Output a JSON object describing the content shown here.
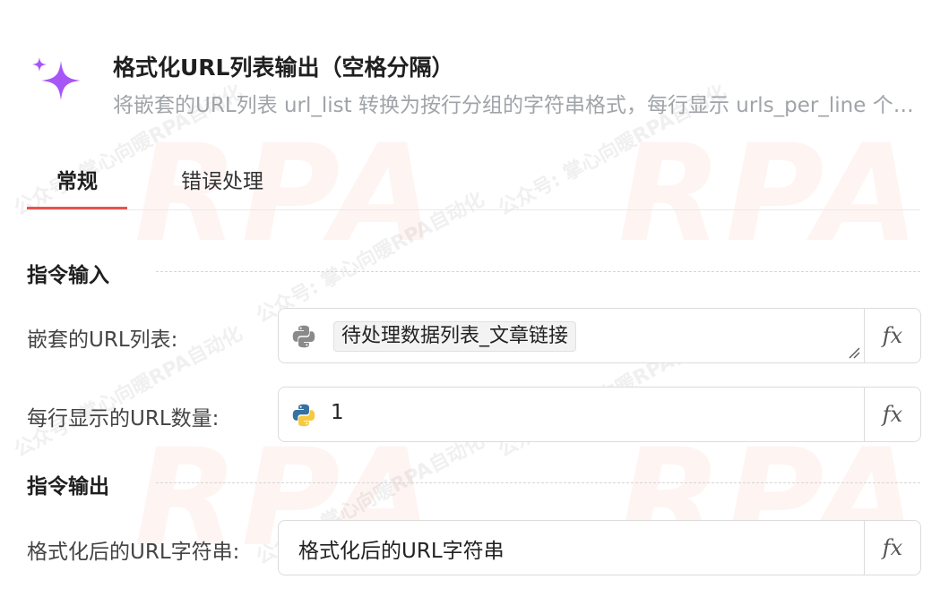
{
  "header": {
    "title": "格式化URL列表输出（空格分隔）",
    "description": "将嵌套的URL列表 url_list 转换为按行分组的字符串格式，每行显示 urls_per_line 个URL，并以空格分隔"
  },
  "tabs": [
    {
      "label": "常规",
      "active": true
    },
    {
      "label": "错误处理",
      "active": false
    }
  ],
  "sections": {
    "input_title": "指令输入",
    "output_title": "指令输出"
  },
  "fields": {
    "nested_url_list": {
      "label": "嵌套的URL列表:",
      "variable_chip": "待处理数据列表_文章链接",
      "icon": "python-icon-gray"
    },
    "urls_per_line": {
      "label": "每行显示的URL数量:",
      "value": "1",
      "icon": "python-icon-color"
    },
    "formatted_output": {
      "label": "格式化后的URL字符串:",
      "value": "格式化后的URL字符串"
    }
  },
  "fx_label": "fx",
  "watermark": {
    "big": "RPA",
    "small": "公众号: 掌心向暖RPA自动化"
  },
  "colors": {
    "tab_indicator": "#e9534f",
    "sparkle": "#a855f7",
    "python_blue": "#3771a1",
    "python_yellow": "#f7c93e",
    "python_gray": "#8a8a8a"
  }
}
